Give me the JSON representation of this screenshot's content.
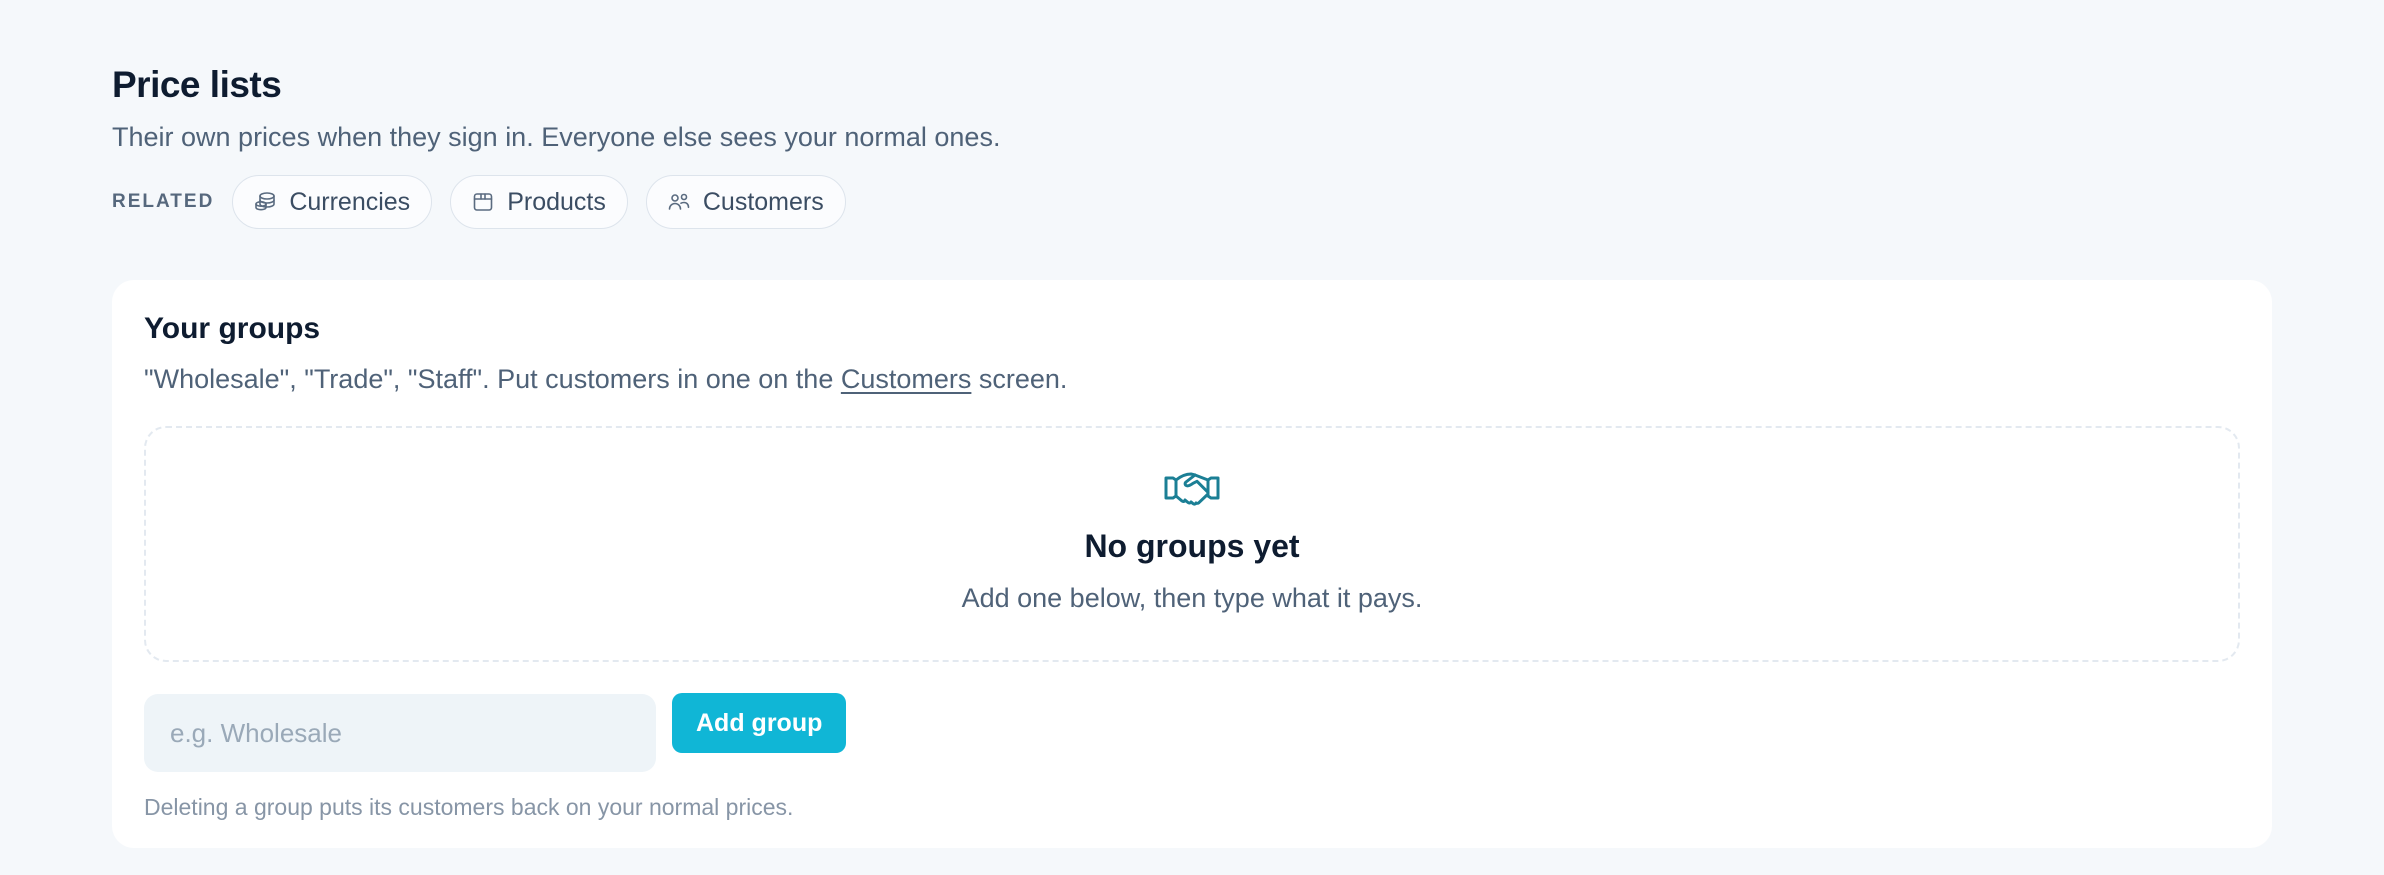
{
  "page": {
    "title": "Price lists",
    "subtitle": "Their own prices when they sign in. Everyone else sees your normal ones."
  },
  "related": {
    "label": "RELATED",
    "links": [
      {
        "label": "Currencies",
        "icon": "coins-icon"
      },
      {
        "label": "Products",
        "icon": "box-icon"
      },
      {
        "label": "Customers",
        "icon": "users-icon"
      }
    ]
  },
  "groups_card": {
    "title": "Your groups",
    "description_prefix": "\"Wholesale\", \"Trade\", \"Staff\". Put customers in one on the ",
    "description_link": "Customers",
    "description_suffix": " screen.",
    "empty_state": {
      "icon": "handshake-icon",
      "title": "No groups yet",
      "text": "Add one below, then type what it pays."
    },
    "input": {
      "placeholder": "e.g. Wholesale",
      "value": ""
    },
    "add_button_label": "Add group",
    "footnote": "Deleting a group puts its customers back on your normal prices."
  },
  "colors": {
    "background": "#f5f8fb",
    "accent": "#10b6d6",
    "icon_teal": "#1b7f95",
    "text_dark": "#0e1c30",
    "text_muted": "#4f6278"
  }
}
